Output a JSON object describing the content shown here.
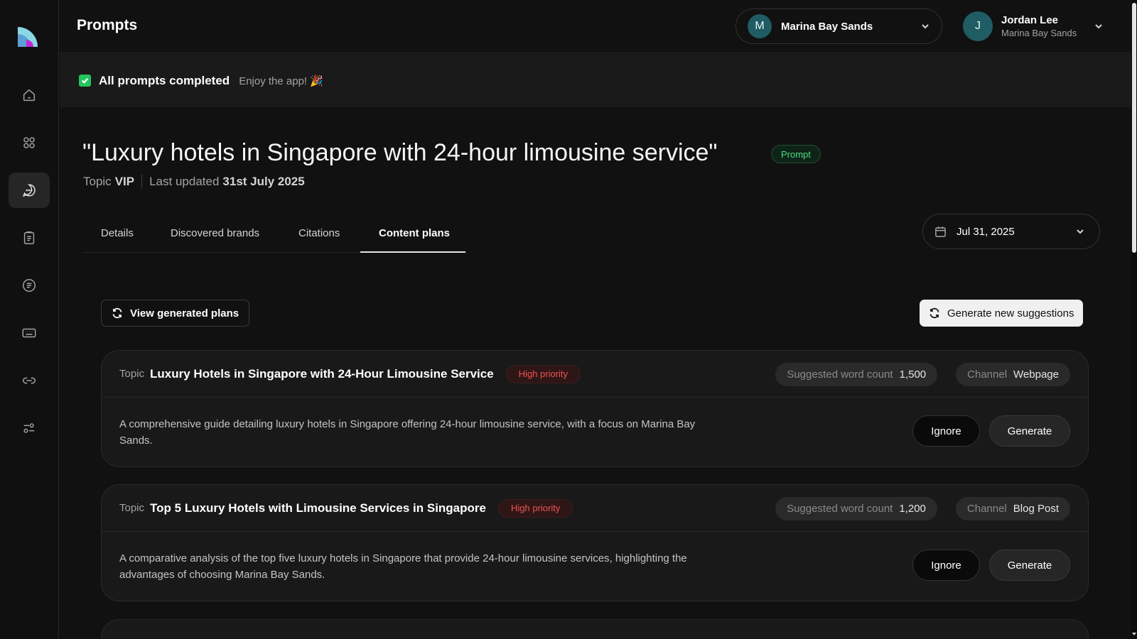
{
  "header": {
    "title": "Prompts",
    "org": {
      "initial": "M",
      "name": "Marina Bay Sands"
    },
    "user": {
      "initial": "J",
      "name": "Jordan Lee",
      "org": "Marina Bay Sands"
    }
  },
  "banner": {
    "title": "All prompts completed",
    "subtitle": "Enjoy the app! 🎉"
  },
  "prompt": {
    "title": "\"Luxury hotels in Singapore with 24-hour limousine service\"",
    "badge": "Prompt",
    "topic_label": "Topic",
    "topic_value": "VIP",
    "updated_label": "Last updated",
    "updated_value": "31st July 2025"
  },
  "tabs": [
    "Details",
    "Discovered brands",
    "Citations",
    "Content plans"
  ],
  "active_tab": "Content plans",
  "date_picker": {
    "value": "Jul 31, 2025"
  },
  "toolbar": {
    "view_plans_label": "View generated plans",
    "generate_suggestions_label": "Generate new suggestions"
  },
  "plans": [
    {
      "topic_label": "Topic",
      "title": "Luxury Hotels in Singapore with 24-Hour Limousine Service",
      "priority": "High priority",
      "word_count_label": "Suggested word count",
      "word_count": "1,500",
      "channel_label": "Channel",
      "channel": "Webpage",
      "description": "A comprehensive guide detailing luxury hotels in Singapore offering 24-hour limousine service, with a focus on Marina Bay Sands.",
      "ignore_label": "Ignore",
      "generate_label": "Generate"
    },
    {
      "topic_label": "Topic",
      "title": "Top 5 Luxury Hotels with Limousine Services in Singapore",
      "priority": "High priority",
      "word_count_label": "Suggested word count",
      "word_count": "1,200",
      "channel_label": "Channel",
      "channel": "Blog Post",
      "description": "A comparative analysis of the top five luxury hotels in Singapore that provide 24-hour limousine services, highlighting the advantages of choosing Marina Bay Sands.",
      "ignore_label": "Ignore",
      "generate_label": "Generate"
    }
  ],
  "sidebar": {
    "items": [
      {
        "icon": "home-icon"
      },
      {
        "icon": "grid-icon"
      },
      {
        "icon": "chat-icon",
        "active": true
      },
      {
        "icon": "clipboard-icon"
      },
      {
        "icon": "list-icon"
      },
      {
        "icon": "keyboard-icon"
      },
      {
        "icon": "link-icon"
      },
      {
        "icon": "sliders-icon"
      }
    ]
  },
  "colors": {
    "background": "#111111",
    "success": "#22c55e",
    "priority": "#f05252",
    "avatar": "#1f5c63"
  }
}
